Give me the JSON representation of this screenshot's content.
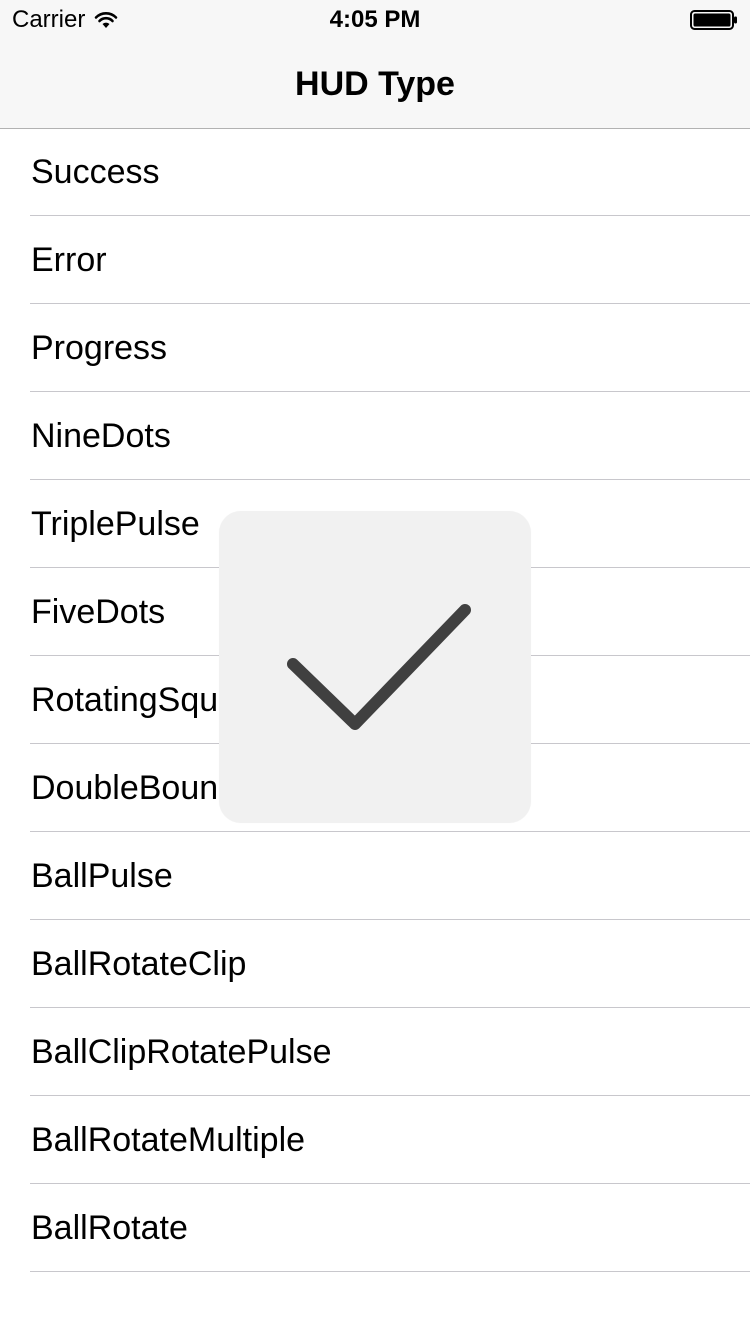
{
  "status_bar": {
    "carrier": "Carrier",
    "time": "4:05 PM",
    "wifi_icon": "wifi-icon",
    "battery_icon": "battery-icon"
  },
  "nav": {
    "title": "HUD Type"
  },
  "table": {
    "rows": [
      {
        "label": "Success"
      },
      {
        "label": "Error"
      },
      {
        "label": "Progress"
      },
      {
        "label": "NineDots"
      },
      {
        "label": "TriplePulse"
      },
      {
        "label": "FiveDots"
      },
      {
        "label": "RotatingSquare"
      },
      {
        "label": "DoubleBounce"
      },
      {
        "label": "BallPulse"
      },
      {
        "label": "BallRotateClip"
      },
      {
        "label": "BallClipRotatePulse"
      },
      {
        "label": "BallRotateMultiple"
      },
      {
        "label": "BallRotate"
      }
    ]
  },
  "hud": {
    "icon": "checkmark-icon",
    "background_color": "#f1f1f1",
    "icon_color": "#404040"
  }
}
